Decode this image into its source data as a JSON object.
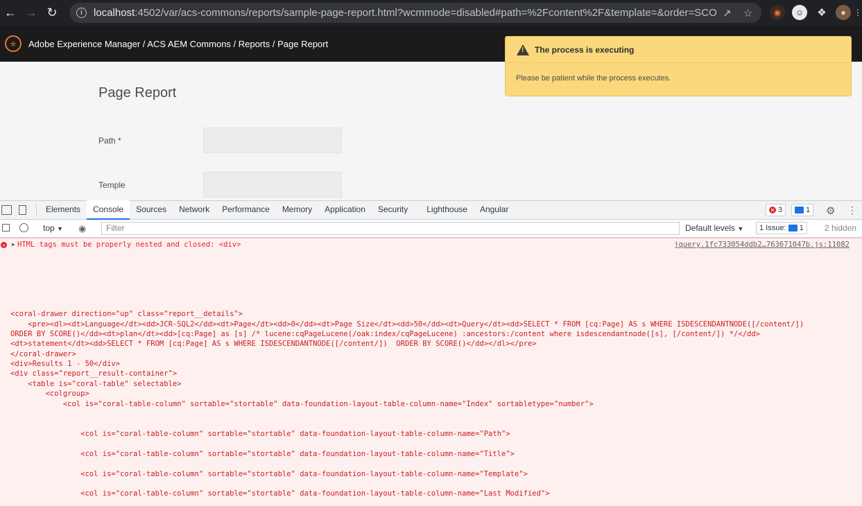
{
  "browser": {
    "url_host": "localhost",
    "url_rest": ":4502/var/acs-commons/reports/sample-page-report.html?wcmmode=disabled#path=%2Fcontent%2F&template=&order=SCORE()&..."
  },
  "aem": {
    "breadcrumb": "Adobe Experience Manager / ACS AEM Commons / Reports / Page Report",
    "page_title": "Page Report",
    "path_label": "Path *",
    "template_label": "Temple"
  },
  "toast": {
    "title": "The process is executing",
    "body": "Please be patient while the process executes."
  },
  "devtools": {
    "tabs": [
      "Elements",
      "Console",
      "Sources",
      "Network",
      "Performance",
      "Memory",
      "Application",
      "Security",
      "Lighthouse",
      "Angular"
    ],
    "error_count": "3",
    "message_count": "1",
    "context": "top",
    "filter_placeholder": "Filter",
    "levels": "Default levels",
    "issues": "1 Issue:",
    "issues_count": "1",
    "hidden": "2 hidden"
  },
  "console": {
    "error_message": "HTML tags must be properly nested and closed: <div>",
    "source": "jquery.1fc733054ddb2…763671047b.js:11082",
    "code_lines": [
      "<coral-drawer direction=\"up\" class=\"report__details\">",
      "    <pre><dl><dt>Language</dt><dd>JCR-SQL2</dd><dt>Page</dt><dd>0</dd><dt>Page Size</dt><dd>50</dd><dt>Query</dt><dd>SELECT * FROM [cq:Page] AS s WHERE ISDESCENDANTNODE([/content/])",
      "ORDER BY SCORE()</dd><dt>plan</dt><dd>[cq:Page] as [s] /* lucene:cqPageLucene(/oak:index/cqPageLucene) :ancestors:/content where isdescendantnode([s], [/content/]) */</dd>",
      "<dt>statement</dt><dd>SELECT * FROM [cq:Page] AS s WHERE ISDESCENDANTNODE([/content/])  ORDER BY SCORE()</dd></dl></pre>",
      "</coral-drawer>",
      "<div>Results 1 - 50</div>",
      "<div class=\"report__result-container\">",
      "    <table is=\"coral-table\" selectable>",
      "        <colgroup>",
      "            <col is=\"coral-table-column\" sortable=\"stortable\" data-foundation-layout-table-column-name=\"Index\" sortabletype=\"number\">",
      "                <col is=\"coral-table-column\" sortable=\"stortable\" data-foundation-layout-table-column-name=\"Path\">",
      "                <col is=\"coral-table-column\" sortable=\"stortable\" data-foundation-layout-table-column-name=\"Title\">",
      "                <col is=\"coral-table-column\" sortable=\"stortable\" data-foundation-layout-table-column-name=\"Template\">",
      "                <col is=\"coral-table-column\" sortable=\"stortable\" data-foundation-layout-table-column-name=\"Last Modified\">"
    ]
  }
}
